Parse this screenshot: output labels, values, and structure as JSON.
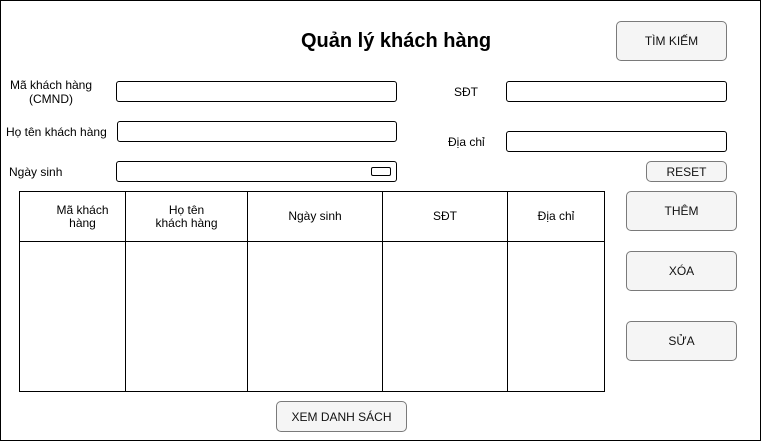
{
  "page": {
    "title": "Quản lý khách hàng"
  },
  "form": {
    "customer_id_label_line1": "Mã khách hàng",
    "customer_id_label_line2": "(CMND)",
    "full_name_label": "Họ tên khách hàng",
    "birth_date_label": "Ngày sinh",
    "phone_label": "SĐT",
    "address_label": "Địa chỉ",
    "customer_id_value": "",
    "full_name_value": "",
    "birth_date_value": "",
    "phone_value": "",
    "address_value": ""
  },
  "buttons": {
    "search": "TÌM KIẾM",
    "reset": "RESET",
    "add": "THÊM",
    "delete": "XÓA",
    "edit": "SỬA",
    "view_list": "XEM DANH SÁCH"
  },
  "table": {
    "columns": [
      {
        "line1": "Mã khách",
        "line2": "hàng"
      },
      {
        "line1": "Họ tên",
        "line2": "khách hàng"
      },
      {
        "line1": "Ngày sinh",
        "line2": ""
      },
      {
        "line1": "SĐT",
        "line2": ""
      },
      {
        "line1": "Địa chỉ",
        "line2": ""
      }
    ],
    "rows": []
  },
  "icons": {
    "date_picker": "calendar-icon"
  }
}
